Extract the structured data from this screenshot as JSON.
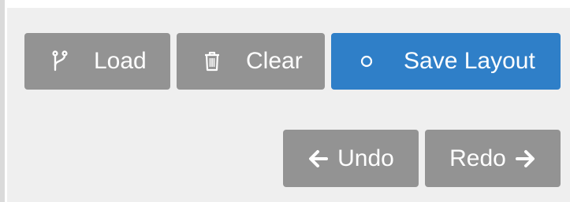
{
  "toolbar": {
    "load": {
      "label": "Load",
      "icon": "branch-icon"
    },
    "clear": {
      "label": "Clear",
      "icon": "trash-icon"
    },
    "save": {
      "label": "Save Layout",
      "icon": "circle-icon"
    }
  },
  "history": {
    "undo": {
      "label": "Undo",
      "icon": "arrow-left-icon"
    },
    "redo": {
      "label": "Redo",
      "icon": "arrow-right-icon"
    }
  },
  "colors": {
    "gray_button": "#939393",
    "primary_button": "#2f7fc8",
    "panel_background": "#efefef"
  }
}
